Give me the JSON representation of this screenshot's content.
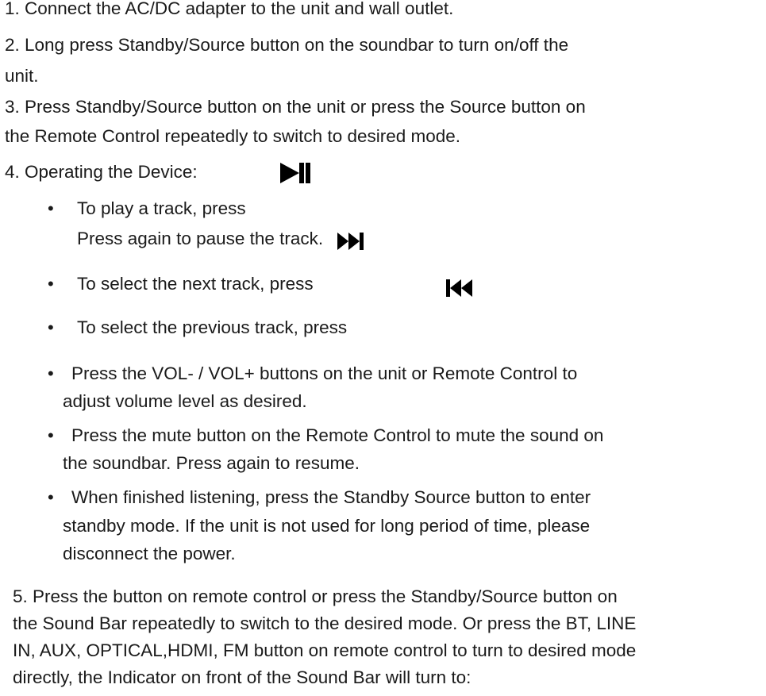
{
  "steps": {
    "s1": "1.  Connect the AC/DC adapter to the unit and wall outlet.",
    "s2a": "2.  Long press Standby/Source button on the soundbar to turn on/off the",
    "s2b": "unit.",
    "s3a": "3.  Press Standby/Source button on the unit or press the Source button on",
    "s3b": "the  Remote Control repeatedly to switch to desired mode.",
    "s4": "4.  Operating the Device:",
    "b1a": "To play a track, press",
    "b1b": "Press again to pause the track.",
    "b2": "To select the next track, press",
    "b3": "To select the previous track, press",
    "b4a": " Press the VOL- / VOL+ buttons on the unit or Remote Control to",
    "b4b": "adjust volume level as desired.",
    "b5a": " Press the mute button on the Remote Control to mute the sound on",
    "b5b": "the soundbar. Press again to resume.",
    "b6a": " When finished listening, press the Standby Source button to enter",
    "b6b": "standby mode. If the unit is not used for long period of time, please",
    "b6c": "disconnect the power.",
    "s5a": "5.  Press the button on remote control or press the Standby/Source button on",
    "s5b": "the Sound Bar repeatedly to switch to the desired mode. Or press the BT, LINE",
    "s5c": "IN, AUX, OPTICAL,HDMI, FM button on remote control to turn to desired mode",
    "s5d": "directly, the Indicator on front of the Sound Bar will turn to:"
  },
  "bullet_char": "•",
  "icons": [
    "play-pause-icon",
    "next-track-icon",
    "previous-track-icon"
  ]
}
